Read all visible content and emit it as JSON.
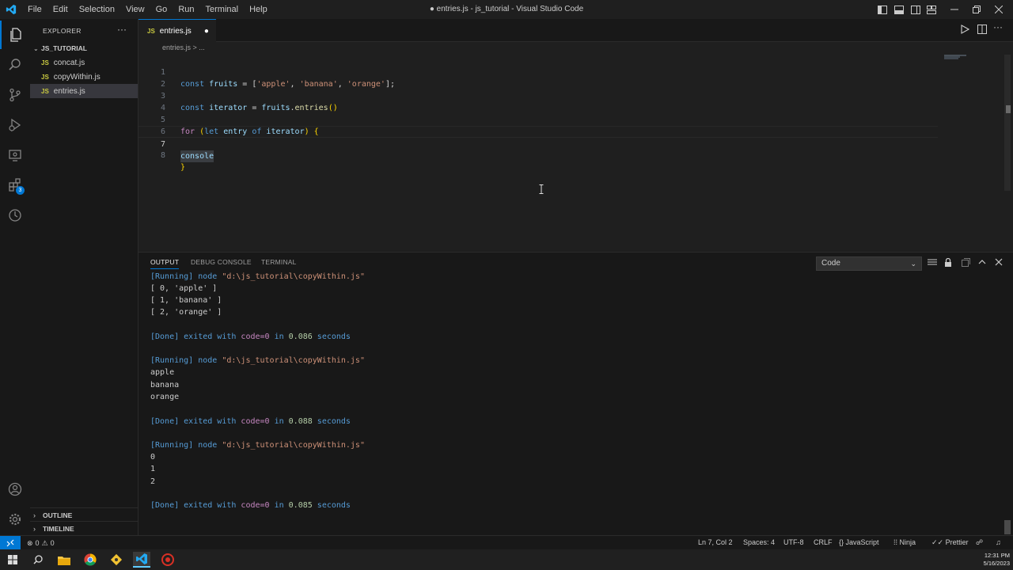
{
  "titlebar": {
    "window_title": "● entries.js - js_tutorial - Visual Studio Code",
    "menu": [
      "File",
      "Edit",
      "Selection",
      "View",
      "Go",
      "Run",
      "Terminal",
      "Help"
    ]
  },
  "sidebar": {
    "title": "EXPLORER",
    "folder": "JS_TUTORIAL",
    "files": [
      {
        "badge": "JS",
        "name": "concat.js"
      },
      {
        "badge": "JS",
        "name": "copyWithin.js"
      },
      {
        "badge": "JS",
        "name": "entries.js"
      }
    ],
    "outline": "OUTLINE",
    "timeline": "TIMELINE"
  },
  "activity": {
    "extensions_badge": "3"
  },
  "editor": {
    "tab": {
      "badge": "JS",
      "name": "entries.js",
      "dirty": "●"
    },
    "breadcrumb": "entries.js > ...",
    "line_numbers": [
      "1",
      "2",
      "3",
      "4",
      "5",
      "6",
      "7",
      "8"
    ],
    "lines": {
      "l1": {
        "kw": "const",
        "var": "fruits",
        "op": " = [",
        "s1": "'apple'",
        "c1": ", ",
        "s2": "'banana'",
        "c2": ", ",
        "s3": "'orange'",
        "end": "];"
      },
      "l3": {
        "kw": "const",
        "var": "iterator",
        "op": " = ",
        "obj": "fruits",
        "dot": ".",
        "fn": "entries",
        "end": "()"
      },
      "l5": {
        "kw": "for",
        "open": " (",
        "kw2": "let",
        "v1": "entry",
        "kw3": "of",
        "v2": "iterator",
        "close": ") {"
      },
      "l7": {
        "text": "console"
      },
      "l8": {
        "text": "}"
      }
    }
  },
  "panel": {
    "tabs": [
      "OUTPUT",
      "DEBUG CONSOLE",
      "TERMINAL"
    ],
    "channel": "Code",
    "runs": [
      {
        "running": "[Running]",
        "cmd": "node",
        "path": "\"d:\\js_tutorial\\copyWithin.js\"",
        "output": [
          "[ 0, 'apple' ]",
          "[ 1, 'banana' ]",
          "[ 2, 'orange' ]"
        ],
        "done": "[Done]",
        "exited": "exited with",
        "code": "code=0",
        "in": "in",
        "time": "0.086",
        "seconds": "seconds"
      },
      {
        "running": "[Running]",
        "cmd": "node",
        "path": "\"d:\\js_tutorial\\copyWithin.js\"",
        "output": [
          "apple",
          "banana",
          "orange"
        ],
        "done": "[Done]",
        "exited": "exited with",
        "code": "code=0",
        "in": "in",
        "time": "0.088",
        "seconds": "seconds"
      },
      {
        "running": "[Running]",
        "cmd": "node",
        "path": "\"d:\\js_tutorial\\copyWithin.js\"",
        "output": [
          "0",
          "1",
          "2"
        ],
        "done": "[Done]",
        "exited": "exited with",
        "code": "code=0",
        "in": "in",
        "time": "0.085",
        "seconds": "seconds"
      }
    ]
  },
  "statusbar": {
    "errors": "0",
    "warnings": "0",
    "position": "Ln 7, Col 2",
    "spaces": "Spaces: 4",
    "encoding": "UTF-8",
    "eol": "CRLF",
    "language": "JavaScript",
    "ninja": "Ninja",
    "prettier": "Prettier"
  },
  "taskbar": {
    "time": "12:31 PM",
    "date": "5/16/2023"
  },
  "colors": {
    "accent": "#0078d4",
    "js_badge": "#cbcb41",
    "keyword": "#569cd6",
    "variable": "#9cdcfe",
    "string": "#ce9178"
  }
}
